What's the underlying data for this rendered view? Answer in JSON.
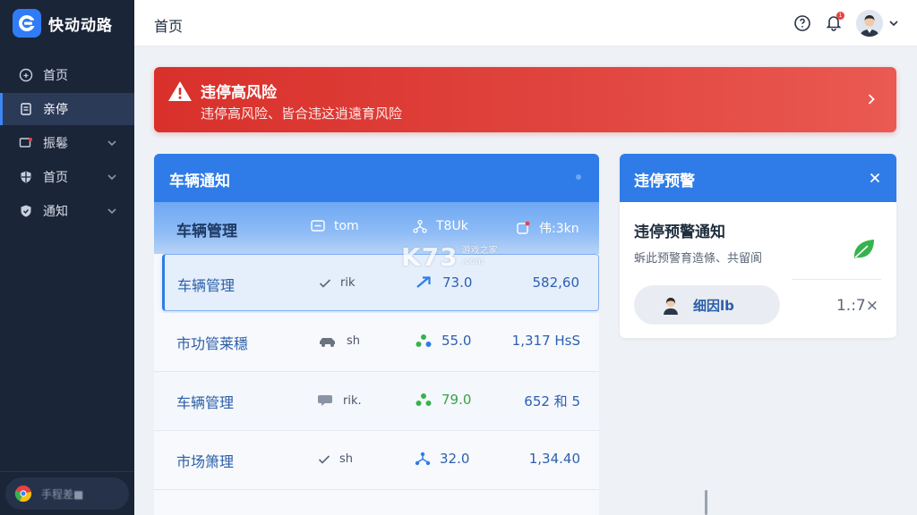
{
  "app": {
    "name": "快动动路"
  },
  "colors": {
    "sidebar": "#1b2538",
    "accent": "#2f7ce8",
    "alert": "#e0443e",
    "leaf": "#37b24d"
  },
  "sidebar": {
    "items": [
      {
        "label": "首页",
        "icon": "home-icon",
        "active": false,
        "expandable": false
      },
      {
        "label": "亲停",
        "icon": "document-icon",
        "active": true,
        "expandable": false
      },
      {
        "label": "振鬈",
        "icon": "monitor-icon",
        "active": false,
        "expandable": true
      },
      {
        "label": "首页",
        "icon": "grid-shield-icon",
        "active": false,
        "expandable": true
      },
      {
        "label": "通知",
        "icon": "shield-icon",
        "active": false,
        "expandable": true
      }
    ],
    "footer_text": "手程差■"
  },
  "header": {
    "title": "首页",
    "bell_badge": "1"
  },
  "alert": {
    "title": "违停高风险",
    "subtitle": "违停高风险、皆合违这逍遠育风险"
  },
  "vehicle_panel": {
    "title": "车辆通知",
    "columns": [
      {
        "label": "车辆管理"
      },
      {
        "label": "tom",
        "icon": "chat-icon"
      },
      {
        "label": "T8Uk",
        "icon": "network-icon"
      },
      {
        "label": "伟:3kn",
        "icon": "tag-icon"
      }
    ],
    "rows": [
      {
        "name": "车辆管理",
        "a_icon": "check-icon",
        "a": "rik",
        "b_icon": "arrow-icon",
        "b": "73.0",
        "c": "582,60",
        "selected": true
      },
      {
        "name": "市功管莱穩",
        "a_icon": "car-icon",
        "a": "sh",
        "b_icon": "group-icon",
        "b": "55.0",
        "c": "1,317 HsS",
        "selected": false
      },
      {
        "name": "车辆管理",
        "a_icon": "chat-icon",
        "a": "rik.",
        "b_icon": "group-icon",
        "b": "79.0",
        "c": "652 和 5",
        "selected": false
      },
      {
        "name": "市场箫理",
        "a_icon": "check-icon",
        "a": "sh",
        "b_icon": "network-icon",
        "b": "32.0",
        "c": "1,34.40",
        "selected": false
      }
    ]
  },
  "warning_card": {
    "title": "违停预警",
    "heading": "违停预警通知",
    "subtitle": "蚸此预警育造條、共留阆",
    "user": "细因lb",
    "count": "1.:7×"
  },
  "watermark": {
    "big": "K73",
    "small_top": "游戏之家",
    "small_bottom": ".com"
  }
}
